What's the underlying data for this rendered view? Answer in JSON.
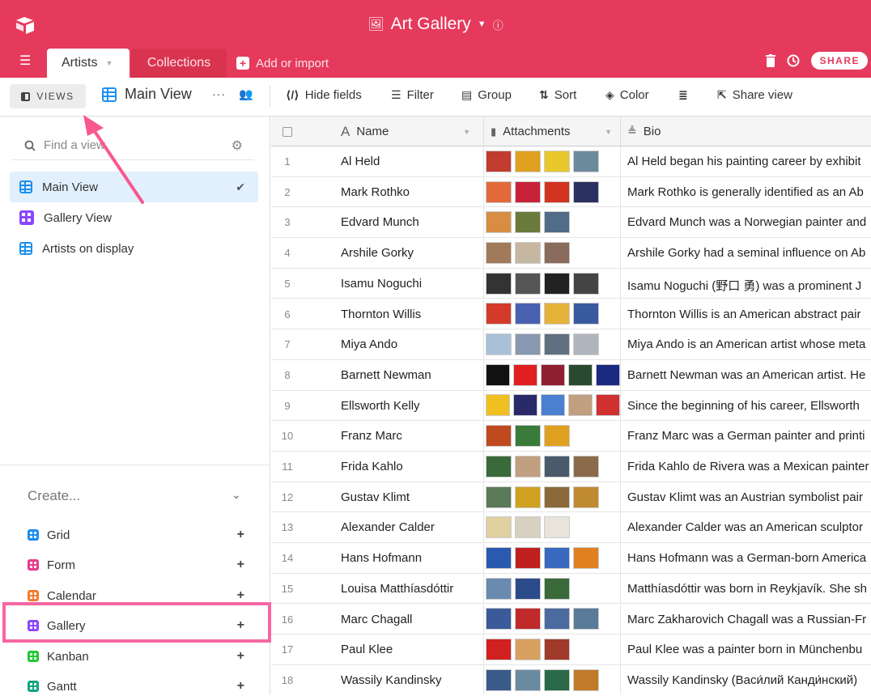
{
  "header": {
    "base_name": "Art Gallery",
    "base_icon": "image-icon",
    "tabs": [
      {
        "label": "Artists",
        "active": true
      },
      {
        "label": "Collections",
        "active": false
      }
    ],
    "add_import_label": "Add or import",
    "share_label": "SHARE",
    "accent_color": "#e53a5c"
  },
  "toolbar": {
    "views_label": "VIEWS",
    "current_view": "Main View",
    "more_label": "···",
    "items": {
      "hide_fields": "Hide fields",
      "filter": "Filter",
      "group": "Group",
      "sort": "Sort",
      "color": "Color",
      "share_view": "Share view"
    }
  },
  "sidebar": {
    "search_placeholder": "Find a view",
    "views": [
      {
        "label": "Main View",
        "type": "grid",
        "selected": true
      },
      {
        "label": "Gallery View",
        "type": "gallery",
        "selected": false
      },
      {
        "label": "Artists on display",
        "type": "grid",
        "selected": false
      }
    ],
    "create_label": "Create...",
    "create_items": [
      {
        "label": "Grid",
        "color": "#1b8ff0"
      },
      {
        "label": "Form",
        "color": "#e8398c"
      },
      {
        "label": "Calendar",
        "color": "#f27c33"
      },
      {
        "label": "Gallery",
        "color": "#8b46ff"
      },
      {
        "label": "Kanban",
        "color": "#20c933"
      },
      {
        "label": "Gantt",
        "color": "#11a582"
      }
    ]
  },
  "grid": {
    "columns": {
      "name": "Name",
      "attachments": "Attachments",
      "bio": "Bio"
    },
    "rows": [
      {
        "num": "1",
        "name": "Al Held",
        "bio": "Al Held began his painting career by exhibit",
        "thumbs": [
          "#c23b2f",
          "#e0a020",
          "#e8c82a",
          "#6b8a9c"
        ]
      },
      {
        "num": "2",
        "name": "Mark Rothko",
        "bio": "Mark Rothko is generally identified as an Ab",
        "thumbs": [
          "#e26a3a",
          "#c8223a",
          "#d2341f",
          "#2b3160"
        ]
      },
      {
        "num": "3",
        "name": "Edvard Munch",
        "bio": "Edvard Munch was a Norwegian painter and",
        "thumbs": [
          "#d78e43",
          "#6a7a3a",
          "#506c88"
        ]
      },
      {
        "num": "4",
        "name": "Arshile Gorky",
        "bio": "Arshile Gorky had a seminal influence on Ab",
        "thumbs": [
          "#a07a5a",
          "#c6b8a0",
          "#8a6c5c"
        ]
      },
      {
        "num": "5",
        "name": "Isamu Noguchi",
        "bio": "Isamu Noguchi (野口 勇) was a prominent J",
        "thumbs": [
          "#333333",
          "#555555",
          "#222222",
          "#444444"
        ]
      },
      {
        "num": "6",
        "name": "Thornton Willis",
        "bio": "Thornton Willis is an American abstract pair",
        "thumbs": [
          "#d43a2a",
          "#4a60b0",
          "#e6b33a",
          "#3a5aa0"
        ]
      },
      {
        "num": "7",
        "name": "Miya Ando",
        "bio": "Miya Ando is an American artist whose meta",
        "thumbs": [
          "#a8c0d8",
          "#8898b0",
          "#607080",
          "#b0b4bc"
        ]
      },
      {
        "num": "8",
        "name": "Barnett Newman",
        "bio": "Barnett Newman was an American artist. He",
        "thumbs": [
          "#111111",
          "#e02020",
          "#902030",
          "#2a4a30",
          "#1a2a80"
        ]
      },
      {
        "num": "9",
        "name": "Ellsworth Kelly",
        "bio": "Since the beginning of his career, Ellsworth",
        "thumbs": [
          "#f0c020",
          "#2a2a6a",
          "#4a80d0",
          "#c0a080",
          "#d03030"
        ]
      },
      {
        "num": "10",
        "name": "Franz Marc",
        "bio": "Franz Marc was a German painter and printi",
        "thumbs": [
          "#c04a20",
          "#3a7a3a",
          "#e0a020"
        ]
      },
      {
        "num": "11",
        "name": "Frida Kahlo",
        "bio": "Frida Kahlo de Rivera was a Mexican painter",
        "thumbs": [
          "#3a6a3a",
          "#c0a080",
          "#4a5a6a",
          "#8a6a4a"
        ]
      },
      {
        "num": "12",
        "name": "Gustav Klimt",
        "bio": "Gustav Klimt was an Austrian symbolist pair",
        "thumbs": [
          "#5a7a5a",
          "#d0a020",
          "#8a6a3a",
          "#c08a30"
        ]
      },
      {
        "num": "13",
        "name": "Alexander Calder",
        "bio": "Alexander Calder was an American sculptor",
        "thumbs": [
          "#e0d0a0",
          "#d8d0c0",
          "#e8e4dc"
        ]
      },
      {
        "num": "14",
        "name": "Hans Hofmann",
        "bio": "Hans Hofmann was a German-born America",
        "thumbs": [
          "#2a5ab0",
          "#c02020",
          "#3a6ac0",
          "#e08020"
        ]
      },
      {
        "num": "15",
        "name": "Louisa Matthíasdóttir",
        "bio": "Matthíasdóttir was born in Reykjavík. She sh",
        "thumbs": [
          "#6a8ab0",
          "#2a4a8a",
          "#3a6a3a"
        ]
      },
      {
        "num": "16",
        "name": "Marc Chagall",
        "bio": "Marc Zakharovich Chagall was a Russian-Fr",
        "thumbs": [
          "#3a5a9a",
          "#c02a2a",
          "#4a6aa0",
          "#5a7a9a"
        ]
      },
      {
        "num": "17",
        "name": "Paul Klee",
        "bio": "Paul Klee was a painter born in Münchenbu",
        "thumbs": [
          "#d02020",
          "#d8a060",
          "#a03a2a"
        ]
      },
      {
        "num": "18",
        "name": "Wassily Kandinsky",
        "bio": "Wassily Kandinsky (Васи́лий Канди́нский)",
        "thumbs": [
          "#3a5a8a",
          "#6a8aa0",
          "#2a6a4a",
          "#c07a2a"
        ]
      }
    ]
  }
}
